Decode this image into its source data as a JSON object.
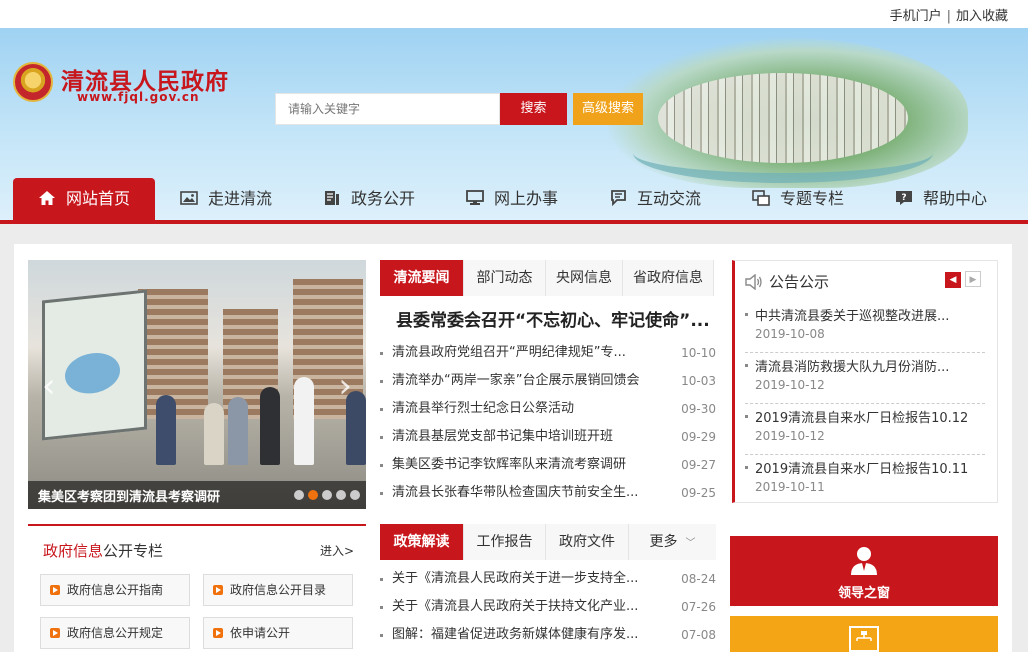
{
  "topbar": {
    "mobile": "手机门户",
    "separator": "|",
    "favorite": "加入收藏"
  },
  "logo": {
    "name": "清流县人民政府",
    "url": "www.fjql.gov.cn"
  },
  "search": {
    "placeholder": "请输入关键字",
    "search_label": "搜索",
    "advanced_label": "高级搜索"
  },
  "nav": {
    "items": [
      {
        "label": "网站首页",
        "icon": "home-icon"
      },
      {
        "label": "走进清流",
        "icon": "picture-icon"
      },
      {
        "label": "政务公开",
        "icon": "document-icon"
      },
      {
        "label": "网上办事",
        "icon": "monitor-icon"
      },
      {
        "label": "互动交流",
        "icon": "chat-icon"
      },
      {
        "label": "专题专栏",
        "icon": "windows-icon"
      },
      {
        "label": "帮助中心",
        "icon": "help-icon"
      }
    ]
  },
  "slider": {
    "caption": "集美区考察团到清流县考察调研",
    "slide_count": 5,
    "active_slide": 2
  },
  "news_panel": {
    "tabs": [
      "清流要闻",
      "部门动态",
      "央网信息",
      "省政府信息"
    ],
    "headline": "县委常委会召开“不忘初心、牢记使命”...",
    "items": [
      {
        "title": "清流县政府党组召开“严明纪律规矩”专...",
        "date": "10-10"
      },
      {
        "title": "清流举办“两岸一家亲”台企展示展销回馈会",
        "date": "10-03"
      },
      {
        "title": "清流县举行烈士纪念日公祭活动",
        "date": "09-30"
      },
      {
        "title": "清流县基层党支部书记集中培训班开班",
        "date": "09-29"
      },
      {
        "title": "集美区委书记李钦辉率队来清流考察调研",
        "date": "09-27"
      },
      {
        "title": "清流县长张春华带队检查国庆节前安全生...",
        "date": "09-25"
      }
    ]
  },
  "notice": {
    "title": "公告公示",
    "items": [
      {
        "title": "中共清流县委关于巡视整改进展...",
        "date": "2019-10-08"
      },
      {
        "title": "清流县消防救援大队九月份消防...",
        "date": "2019-10-12"
      },
      {
        "title": "2019清流县自来水厂日检报告10.12",
        "date": "2019-10-12"
      },
      {
        "title": "2019清流县自来水厂日检报告10.11",
        "date": "2019-10-11"
      }
    ]
  },
  "info_panel": {
    "title_red": "政府信息",
    "title_rest": "公开专栏",
    "more": "进入>",
    "buttons": [
      "政府信息公开指南",
      "政府信息公开目录",
      "政府信息公开规定",
      "依申请公开"
    ]
  },
  "policy_panel": {
    "tabs": [
      "政策解读",
      "工作报告",
      "政府文件",
      "更多"
    ],
    "items": [
      {
        "title": "关于《清流县人民政府关于进一步支持全...",
        "date": "08-24"
      },
      {
        "title": "关于《清流县人民政府关于扶持文化产业...",
        "date": "07-26"
      },
      {
        "title": "图解：福建省促进政务新媒体健康有序发...",
        "date": "07-08"
      }
    ]
  },
  "blocks": {
    "leader": "领导之窗"
  },
  "colors": {
    "brand_red": "#c8161d",
    "accent_orange": "#f0a21b",
    "block_yellow": "#f3a516"
  }
}
